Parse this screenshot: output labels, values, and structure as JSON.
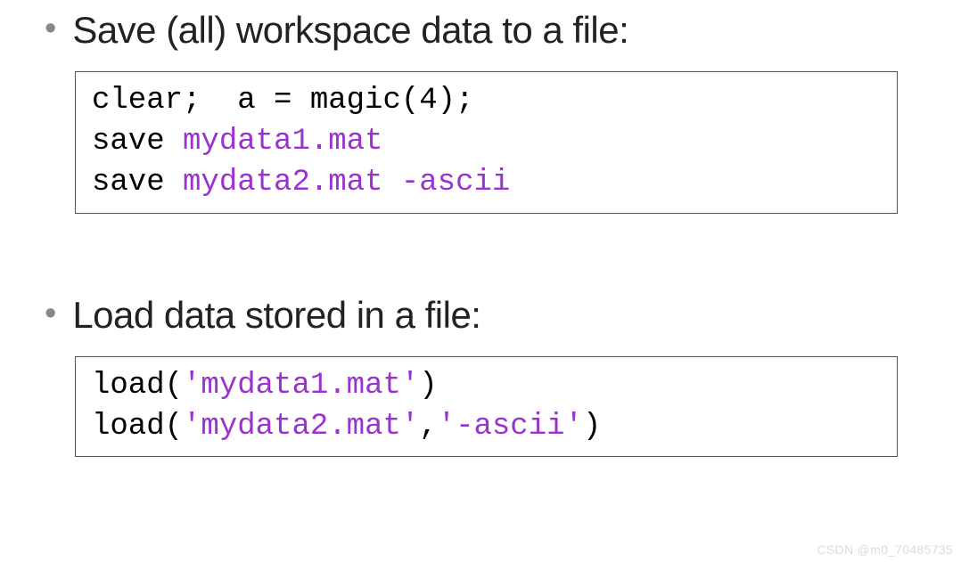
{
  "section1": {
    "heading": "Save (all) workspace data to a file:",
    "code_line1_a": "clear;  a = magic(4);",
    "code_line2_a": "save ",
    "code_line2_b": "mydata1.mat",
    "code_line3_a": "save ",
    "code_line3_b": "mydata2.mat -ascii"
  },
  "section2": {
    "heading": "Load data stored in a file:",
    "code_line1_a": "load(",
    "code_line1_b": "'mydata1.mat'",
    "code_line1_c": ")",
    "code_line2_a": "load(",
    "code_line2_b": "'mydata2.mat'",
    "code_line2_c": ",",
    "code_line2_d": "'-ascii'",
    "code_line2_e": ")"
  },
  "watermark": "CSDN @m0_70485735"
}
